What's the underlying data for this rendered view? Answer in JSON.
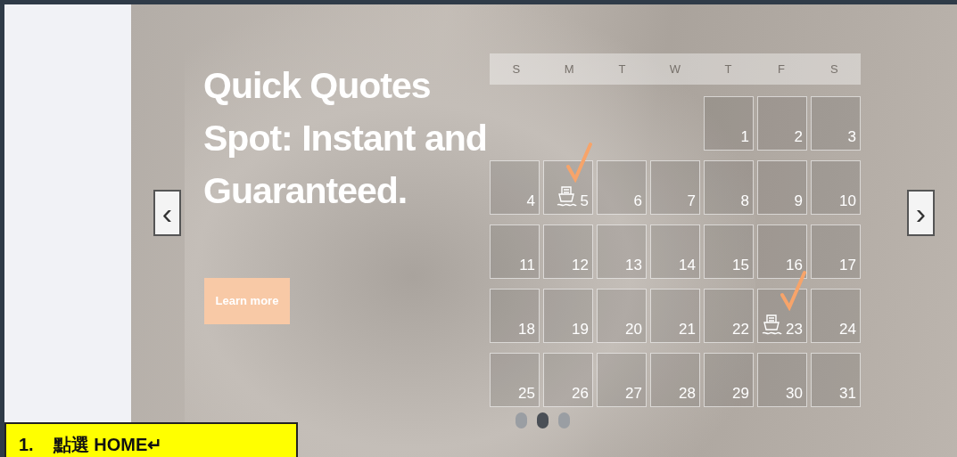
{
  "carousel": {
    "heading_lines": [
      "Quick Quotes",
      "Spot: Instant and",
      "Guaranteed."
    ],
    "button": "Learn more",
    "prev": "‹",
    "next": "›",
    "calendar": {
      "weekdays": [
        "S",
        "M",
        "T",
        "W",
        "T",
        "F",
        "S"
      ],
      "weeks": [
        [
          {
            "kind": "empty"
          },
          {
            "kind": "empty"
          },
          {
            "kind": "empty"
          },
          {
            "kind": "empty"
          },
          {
            "kind": "day",
            "day": "1",
            "marked": false
          },
          {
            "kind": "day",
            "day": "2",
            "marked": false
          },
          {
            "kind": "day",
            "day": "3",
            "marked": false
          }
        ],
        [
          {
            "kind": "day",
            "day": "4",
            "marked": false
          },
          {
            "kind": "day",
            "day": "5",
            "marked": true
          },
          {
            "kind": "day",
            "day": "6",
            "marked": false
          },
          {
            "kind": "day",
            "day": "7",
            "marked": false
          },
          {
            "kind": "day",
            "day": "8",
            "marked": false
          },
          {
            "kind": "day",
            "day": "9",
            "marked": false
          },
          {
            "kind": "day",
            "day": "10",
            "marked": false
          }
        ],
        [
          {
            "kind": "day",
            "day": "11",
            "marked": false
          },
          {
            "kind": "day",
            "day": "12",
            "marked": false
          },
          {
            "kind": "day",
            "day": "13",
            "marked": false
          },
          {
            "kind": "day",
            "day": "14",
            "marked": false
          },
          {
            "kind": "day",
            "day": "15",
            "marked": false
          },
          {
            "kind": "day",
            "day": "16",
            "marked": false
          },
          {
            "kind": "day",
            "day": "17",
            "marked": false
          }
        ],
        [
          {
            "kind": "day",
            "day": "18",
            "marked": false
          },
          {
            "kind": "day",
            "day": "19",
            "marked": false
          },
          {
            "kind": "day",
            "day": "20",
            "marked": false
          },
          {
            "kind": "day",
            "day": "21",
            "marked": false
          },
          {
            "kind": "day",
            "day": "22",
            "marked": false
          },
          {
            "kind": "day",
            "day": "23",
            "marked": true
          },
          {
            "kind": "day",
            "day": "24",
            "marked": false
          }
        ],
        [
          {
            "kind": "day",
            "day": "25",
            "marked": false
          },
          {
            "kind": "day",
            "day": "26",
            "marked": false
          },
          {
            "kind": "day",
            "day": "27",
            "marked": false
          },
          {
            "kind": "day",
            "day": "28",
            "marked": false
          },
          {
            "kind": "day",
            "day": "29",
            "marked": false
          },
          {
            "kind": "day",
            "day": "30",
            "marked": false
          },
          {
            "kind": "day",
            "day": "31",
            "marked": false
          }
        ]
      ]
    },
    "dots": [
      {
        "selected": false
      },
      {
        "selected": true
      },
      {
        "selected": false
      }
    ]
  },
  "note": {
    "number": "1.",
    "text": "點選 HOME↵"
  }
}
